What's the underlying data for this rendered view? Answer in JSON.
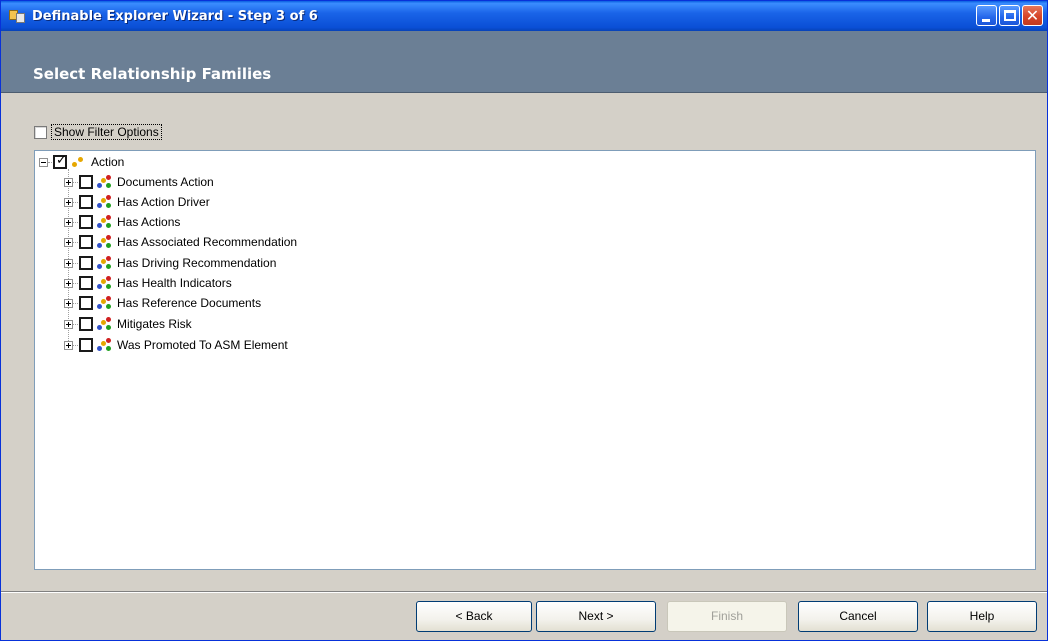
{
  "window": {
    "title": "Definable Explorer Wizard - Step 3 of 6",
    "accent_color": "#0a4fd6"
  },
  "banner": {
    "title": "Select Relationship Families",
    "background": "#6b7f95"
  },
  "filter": {
    "label": "Show Filter Options",
    "checked": false
  },
  "tree": {
    "root": {
      "label": "Action",
      "checked": true,
      "expanded": true,
      "icon": "family-icon"
    },
    "children": [
      {
        "label": "Documents Action",
        "checked": false,
        "icon": "relationship-icon"
      },
      {
        "label": "Has Action Driver",
        "checked": false,
        "icon": "relationship-icon"
      },
      {
        "label": "Has Actions",
        "checked": false,
        "icon": "relationship-icon"
      },
      {
        "label": "Has Associated Recommendation",
        "checked": false,
        "icon": "relationship-icon"
      },
      {
        "label": "Has Driving Recommendation",
        "checked": false,
        "icon": "relationship-icon"
      },
      {
        "label": "Has Health Indicators",
        "checked": false,
        "icon": "relationship-icon"
      },
      {
        "label": "Has Reference Documents",
        "checked": false,
        "icon": "relationship-icon"
      },
      {
        "label": "Mitigates Risk",
        "checked": false,
        "icon": "relationship-icon"
      },
      {
        "label": "Was Promoted To ASM Element",
        "checked": false,
        "icon": "relationship-icon"
      }
    ]
  },
  "buttons": {
    "back": "< Back",
    "next": "Next >",
    "finish": "Finish",
    "cancel": "Cancel",
    "help": "Help"
  }
}
